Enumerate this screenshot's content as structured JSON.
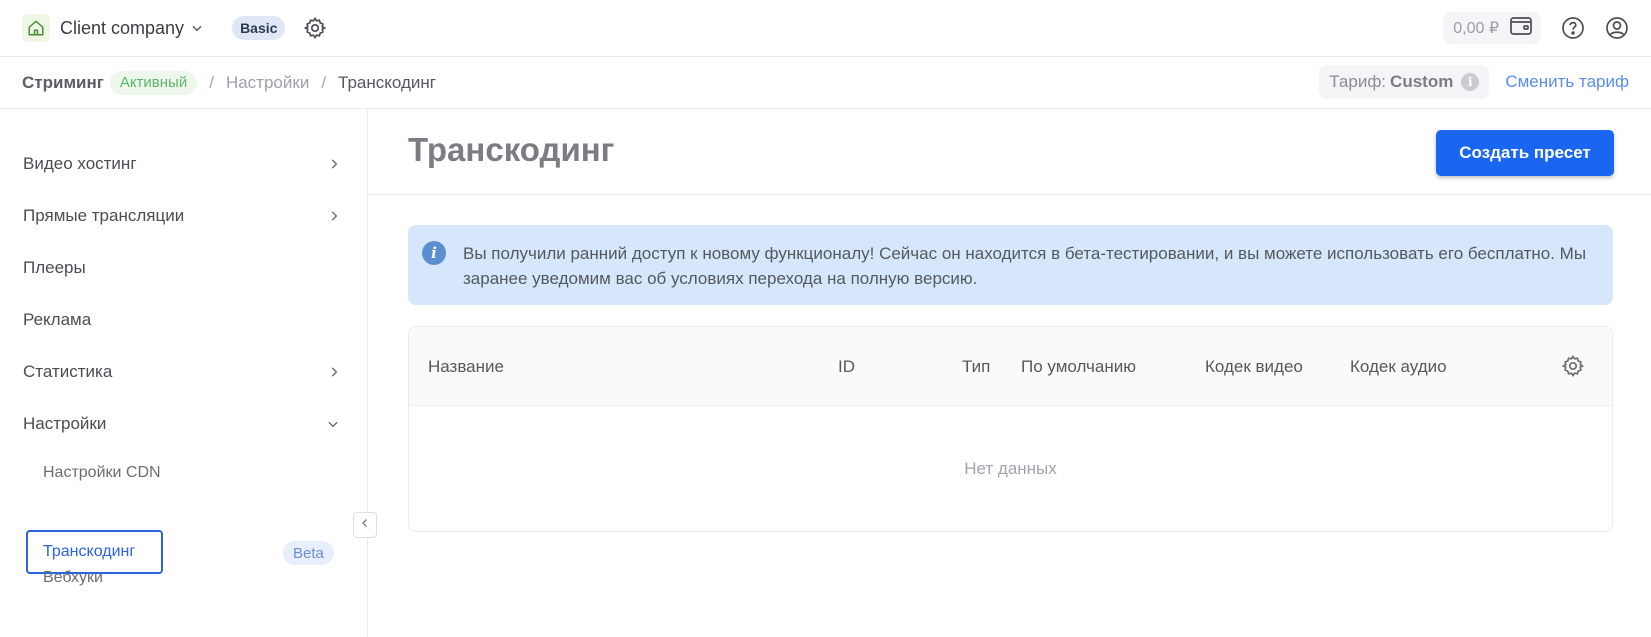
{
  "topbar": {
    "company": "Client company",
    "plan": "Basic",
    "balance": "0,00 ₽"
  },
  "breadcrumb": {
    "section": "Стриминг",
    "status": "Активный",
    "items": [
      "Настройки",
      "Транскодинг"
    ],
    "separator": "/"
  },
  "tariff": {
    "label": "Тариф:",
    "value": "Custom",
    "info": "i",
    "change_link": "Сменить тариф"
  },
  "sidebar": {
    "items": [
      {
        "label": "Видео хостинг",
        "chevron": "right"
      },
      {
        "label": "Прямые трансляции",
        "chevron": "right"
      },
      {
        "label": "Плееры"
      },
      {
        "label": "Реклама"
      },
      {
        "label": "Статистика",
        "chevron": "right"
      },
      {
        "label": "Настройки",
        "chevron": "down"
      }
    ],
    "subitems": [
      {
        "label": "Настройки CDN"
      },
      {
        "label": "Транскодинг",
        "active": true,
        "badge": "Beta"
      },
      {
        "label": "Вебхуки"
      }
    ]
  },
  "main": {
    "title": "Транскодинг",
    "create_button": "Создать пресет",
    "alert": {
      "icon": "i",
      "text": "Вы получили ранний доступ к новому функционалу! Сейчас он находится в бета-тестировании, и вы можете использовать его бесплатно. Мы заранее уведомим вас об условиях перехода на полную версию."
    },
    "table": {
      "columns": [
        "Название",
        "ID",
        "Тип",
        "По умолчанию",
        "Кодек видео",
        "Кодек аудио"
      ],
      "empty_text": "Нет данных"
    }
  },
  "colors": {
    "primary": "#1a66f0",
    "link": "#5b8def",
    "active_border": "#2b62e2",
    "alert_bg": "#d6e7fb",
    "status_green": "#5cb56a"
  }
}
